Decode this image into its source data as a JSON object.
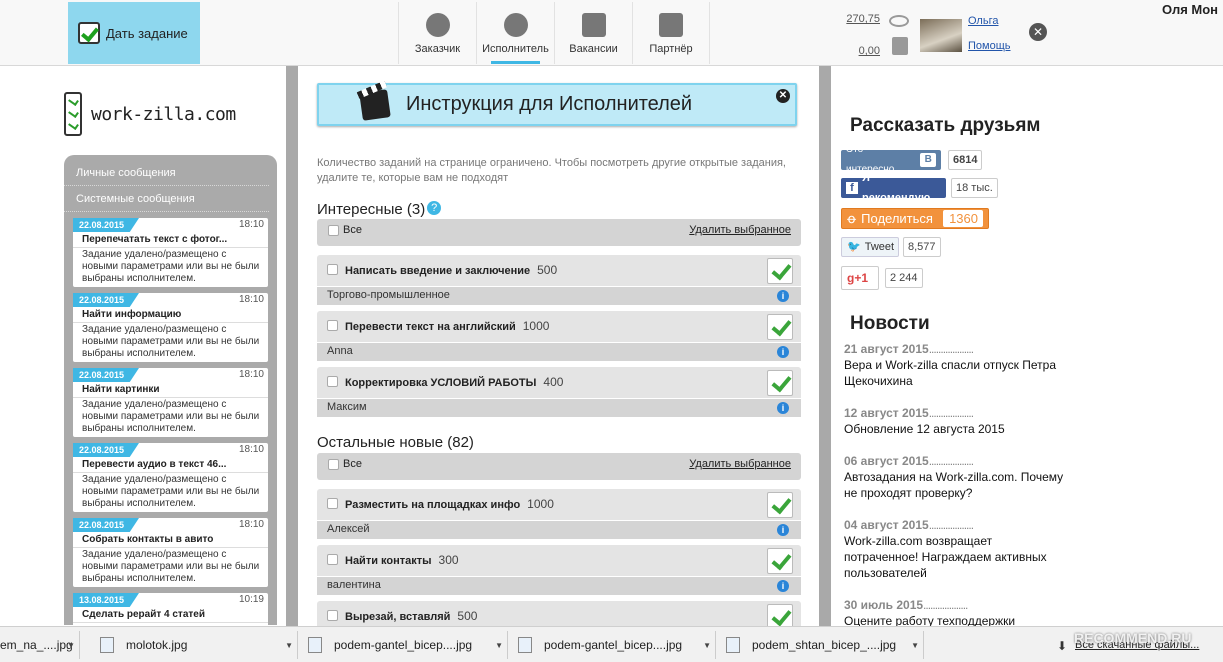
{
  "topnav": {
    "task_button": "Дать задание",
    "tabs": [
      {
        "label": "Заказчик",
        "icon": "customer-icon"
      },
      {
        "label": "Исполнитель",
        "icon": "executor-icon",
        "active": true
      },
      {
        "label": "Вакансии",
        "icon": "vacancies-icon"
      },
      {
        "label": "Партнёр",
        "icon": "partner-icon"
      }
    ],
    "balance_1": "270,75",
    "balance_2": "0,00",
    "user_name": "Ольга",
    "help": "Помощь",
    "browser_user": "Оля Мон"
  },
  "logo": {
    "text": "work-zilla.com"
  },
  "sidebar": {
    "personal_messages": "Личные сообщения",
    "system_messages": "Системные сообщения",
    "messages": [
      {
        "date": "22.08.2015",
        "time": "18:10",
        "title": "Перепечатать текст с фотог...",
        "body": "Задание удалено/размещено с новыми параметрами или вы не были выбраны исполнителем."
      },
      {
        "date": "22.08.2015",
        "time": "18:10",
        "title": "Найти информацию",
        "body": "Задание удалено/размещено с новыми параметрами или вы не были выбраны исполнителем."
      },
      {
        "date": "22.08.2015",
        "time": "18:10",
        "title": "Найти картинки",
        "body": "Задание удалено/размещено с новыми параметрами или вы не были выбраны исполнителем."
      },
      {
        "date": "22.08.2015",
        "time": "18:10",
        "title": "Перевести аудио в текст 46...",
        "body": "Задание удалено/размещено с новыми параметрами или вы не были выбраны исполнителем."
      },
      {
        "date": "22.08.2015",
        "time": "18:10",
        "title": "Собрать контакты в авито",
        "body": "Задание удалено/размещено с новыми параметрами или вы не были выбраны исполнителем."
      },
      {
        "date": "13.08.2015",
        "time": "10:19",
        "title": "Сделать рерайт 4 статей",
        "body": ""
      }
    ]
  },
  "main": {
    "instructions_banner": "Инструкция для Исполнителей",
    "notice": "Количество заданий на странице ограничено. Чтобы посмотреть другие открытые задания, удалите те, которые вам не подходят",
    "interesting": {
      "title": "Интересные (3)",
      "all_label": "Все",
      "delete_selected": "Удалить выбранное",
      "tasks": [
        {
          "title": "Написать введение и заключение",
          "price": "500",
          "sub": "Торгово-промышленное"
        },
        {
          "title": "Перевести текст на английский",
          "price": "1000",
          "sub": "Anna"
        },
        {
          "title": "Корректировка УСЛОВИЙ РАБОТЫ",
          "price": "400",
          "sub": "Максим"
        }
      ]
    },
    "other_new": {
      "title": "Остальные новые (82)",
      "all_label": "Все",
      "delete_selected": "Удалить выбранное",
      "tasks": [
        {
          "title": "Разместить на площадках инфо",
          "price": "1000",
          "sub": "Алексей"
        },
        {
          "title": "Найти контакты",
          "price": "300",
          "sub": "валентина"
        },
        {
          "title": "Вырезай, вставляй",
          "price": "500",
          "sub": ""
        }
      ]
    }
  },
  "right": {
    "share_title": "Рассказать друзьям",
    "vk_label": "Это интересно",
    "vk_count": "6814",
    "fb_label": "Я рекомендую",
    "fb_count": "18 тыс.",
    "ok_label": "Поделиться",
    "ok_count": "1360",
    "tw_label": "Tweet",
    "tw_count": "8,577",
    "gp_label": "g+1",
    "gp_count": "2 244",
    "news_title": "Новости",
    "news": [
      {
        "date": "21 август 2015",
        "text": "Вера и Work-zilla спасли отпуск Петра Щекочихина"
      },
      {
        "date": "12 август 2015",
        "text": "Обновление 12 августа 2015"
      },
      {
        "date": "06 август 2015",
        "text": "Автозадания на Work-zilla.com. Почему не проходят проверку?"
      },
      {
        "date": "04 август 2015",
        "text": "Work-zilla.com возвращает потраченное! Награждаем активных пользователей"
      },
      {
        "date": "30 июль 2015",
        "text": "Оцените работу техподдержки"
      }
    ]
  },
  "downloads": {
    "items": [
      "em_na_....jpg",
      "molotok.jpg",
      "podem-gantel_bicep....jpg",
      "podem-gantel_bicep....jpg",
      "podem_shtan_bicep_....jpg"
    ],
    "all_files": "Все скачанные файлы..."
  },
  "watermark": "RECOMMEND.RU",
  "colors": {
    "accent": "#3fb7e4",
    "task_button_bg": "#8ed7ee",
    "check_green": "#3aa53a",
    "sidebar_gray": "#aaaaaa"
  }
}
